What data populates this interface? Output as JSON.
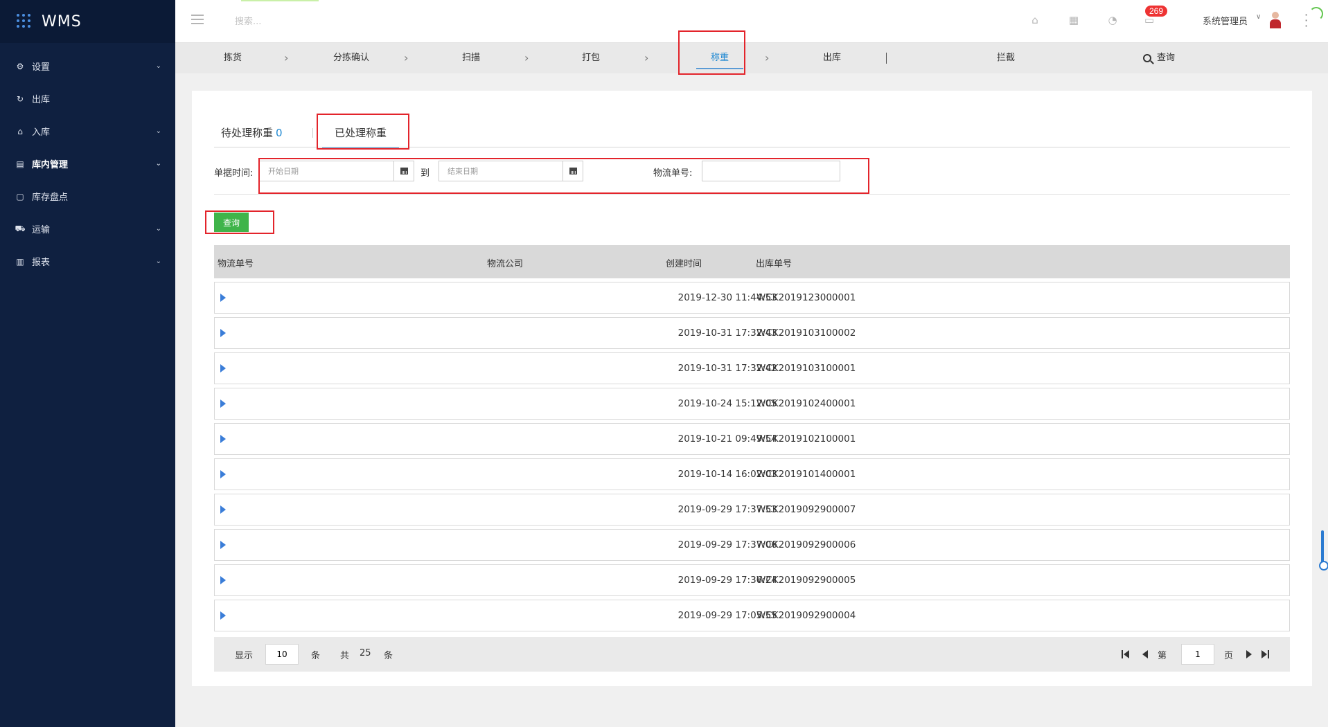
{
  "app": {
    "title": "WMS"
  },
  "sidebar": {
    "items": [
      {
        "label": "设置",
        "icon": "gear-icon",
        "glyph": "⚙",
        "caret": true,
        "active": false
      },
      {
        "label": "出库",
        "icon": "outbound-icon",
        "glyph": "↻",
        "caret": false,
        "active": false
      },
      {
        "label": "入库",
        "icon": "inbound-icon",
        "glyph": "⌂",
        "caret": true,
        "active": false
      },
      {
        "label": "库内管理",
        "icon": "warehouse-icon",
        "glyph": "▤",
        "caret": true,
        "active": true
      },
      {
        "label": "库存盘点",
        "icon": "inventory-icon",
        "glyph": "▢",
        "caret": false,
        "active": false
      },
      {
        "label": "运输",
        "icon": "truck-icon",
        "glyph": "⛟",
        "caret": true,
        "active": false
      },
      {
        "label": "报表",
        "icon": "bar-chart-icon",
        "glyph": "▥",
        "caret": true,
        "active": false
      }
    ]
  },
  "topbar": {
    "search_placeholder": "搜索...",
    "notification_count": "269",
    "user_name": "系统管理员"
  },
  "steps": {
    "pick": "拣货",
    "sort_confirm": "分拣确认",
    "scan": "扫描",
    "pack": "打包",
    "weigh": "称重",
    "ship": "出库",
    "intercept": "拦截",
    "query": "查询"
  },
  "tabs": {
    "pending_label": "待处理称重",
    "pending_count": "0",
    "processed_label": "已处理称重"
  },
  "filters": {
    "doc_time_label": "单据时间:",
    "start_placeholder": "开始日期",
    "to_label": "到",
    "end_placeholder": "结束日期",
    "tracking_label": "物流单号:",
    "tracking_value": ""
  },
  "query_button": "查询",
  "table": {
    "headers": {
      "tracking_no": "物流单号",
      "carrier": "物流公司",
      "created_time": "创建时间",
      "outbound_no": "出库单号"
    },
    "rows": [
      {
        "created_time": "2019-12-30 11:44:53",
        "outbound_no": "WCK2019123000001"
      },
      {
        "created_time": "2019-10-31 17:32:43",
        "outbound_no": "WCK2019103100002"
      },
      {
        "created_time": "2019-10-31 17:32:42",
        "outbound_no": "WCK2019103100001"
      },
      {
        "created_time": "2019-10-24 15:12:05",
        "outbound_no": "WCK2019102400001"
      },
      {
        "created_time": "2019-10-21 09:49:54",
        "outbound_no": "WCK2019102100001"
      },
      {
        "created_time": "2019-10-14 16:02:03",
        "outbound_no": "WCK2019101400001"
      },
      {
        "created_time": "2019-09-29 17:37:53",
        "outbound_no": "WCK2019092900007"
      },
      {
        "created_time": "2019-09-29 17:37:06",
        "outbound_no": "WCK2019092900006"
      },
      {
        "created_time": "2019-09-29 17:36:24",
        "outbound_no": "WCK2019092900005"
      },
      {
        "created_time": "2019-09-29 17:05:55",
        "outbound_no": "WCK2019092900004"
      }
    ]
  },
  "pager": {
    "show_label": "显示",
    "page_size": "10",
    "per_unit": "条",
    "total_label": "共",
    "total": "25",
    "total_unit": "条",
    "page_prefix": "第",
    "current_page": "1",
    "page_suffix": "页"
  },
  "colors": {
    "sidebar_bg": "#0f2040",
    "accent_blue": "#1e88d2",
    "query_green": "#3fb44a",
    "highlight_red": "#e3242b",
    "badge_red": "#e33"
  }
}
